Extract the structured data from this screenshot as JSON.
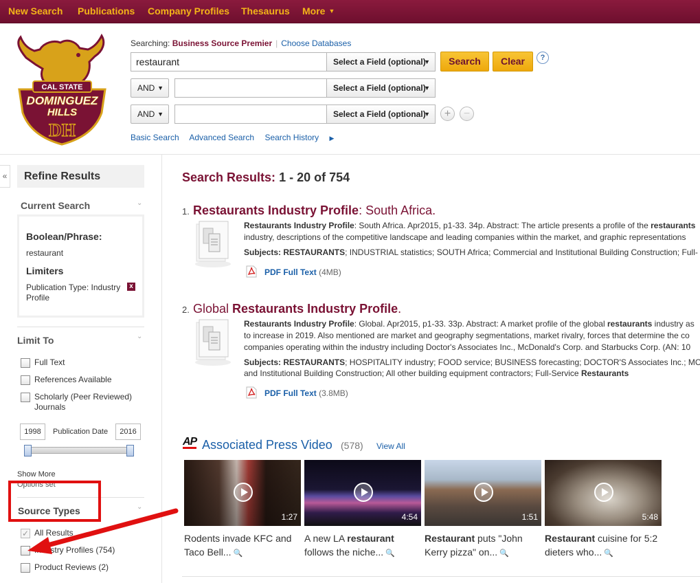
{
  "nav": {
    "items": [
      "New Search",
      "Publications",
      "Company Profiles",
      "Thesaurus",
      "More"
    ],
    "colors": {
      "bar": "#7a1234",
      "text": "#f3b418"
    }
  },
  "logo": {
    "line1": "CAL STATE",
    "line2": "DOMINGUEZ",
    "line3": "HILLS",
    "mono": "DH"
  },
  "search": {
    "searching_label": "Searching:",
    "database": "Business Source Premier",
    "choose_db": "Choose Databases",
    "query": "restaurant",
    "field_label": "Select a Field (optional)",
    "bool1": "AND",
    "bool2": "AND",
    "search_btn": "Search",
    "clear_btn": "Clear",
    "help": "?",
    "add": "+",
    "remove": "−",
    "links": [
      "Basic Search",
      "Advanced Search",
      "Search History"
    ]
  },
  "refine": {
    "title": "Refine Results",
    "collapse": "«",
    "current_search": {
      "title": "Current Search",
      "boolean_label": "Boolean/Phrase:",
      "boolean_value": "restaurant",
      "limiters_label": "Limiters",
      "limiter_line1": "Publication Type: Industry",
      "limiter_line2": "Profile",
      "remove": "x"
    },
    "limit_to": {
      "title": "Limit To",
      "options": [
        "Full Text",
        "References Available",
        "Scholarly (Peer Reviewed)",
        "Journals"
      ],
      "year_from": "1998",
      "year_to": "2016",
      "date_label": "Publication Date",
      "show_more": "Show More",
      "options_set": "Options set"
    },
    "source_types": {
      "title": "Source Types",
      "items": [
        "All Results",
        "Industry Profiles (754)",
        "Product Reviews (2)"
      ]
    }
  },
  "results": {
    "header_label": "Search Results:",
    "header_count": "1 - 20 of 754",
    "items": [
      {
        "num": "1.",
        "title_bold": "Restaurants Industry Profile",
        "title_rest": ": South Africa.",
        "line1_bold": "Restaurants Industry Profile",
        "line1": ": South Africa. Apr2015, p1-33. 34p. Abstract: The article presents a profile of the ",
        "line1_bold2": "restaurants",
        "line2": "industry, descriptions of the competitive landscape and leading companies within the market, and graphic representations",
        "subj_label": "Subjects: ",
        "subj_bold": "RESTAURANTS",
        "subj_rest": "; INDUSTRIAL statistics; SOUTH Africa; Commercial and Institutional Building Construction; Full-",
        "pdf_label": "PDF Full Text",
        "pdf_size": "(4MB)"
      },
      {
        "num": "2.",
        "title_pre": "Global ",
        "title_bold": "Restaurants Industry Profile",
        "title_rest": ".",
        "line1_bold": "Restaurants Industry Profile",
        "line1": ": Global. Apr2015, p1-33. 33p. Abstract: A market profile of the global ",
        "line1_bold2": "restaurants",
        "line1_end": " industry as",
        "line2": "to increase in 2019. Also mentioned are market and geography segmentations, market rivalry, forces that determine the co",
        "line3": "companies operating within the industry including Doctor's Associates Inc., McDonald's Corp. and Starbucks Corp. (AN: 10",
        "subj_label": "Subjects: ",
        "subj_bold": "RESTAURANTS",
        "subj_rest": "; HOSPITALITY industry; FOOD service; BUSINESS forecasting; DOCTOR'S Associates Inc.; MCD",
        "subj_line2": "and Institutional Building Construction; All other building equipment contractors; Full-Service ",
        "subj_line2_bold": "Restaurants",
        "pdf_label": "PDF Full Text",
        "pdf_size": "(3.8MB)"
      }
    ]
  },
  "videos": {
    "logo": "AP",
    "title": "Associated Press Video",
    "count": "(578)",
    "view_all": "View All",
    "items": [
      {
        "duration": "1:27",
        "cap_pre": "",
        "cap_bold": "",
        "cap_rest": "Rodents invade KFC and Taco Bell..."
      },
      {
        "duration": "4:54",
        "cap_pre": "A new LA ",
        "cap_bold": "restaurant",
        "cap_rest": " follows the niche..."
      },
      {
        "duration": "1:51",
        "cap_pre": "",
        "cap_bold": "Restaurant",
        "cap_rest": " puts \"John Kerry pizza\" on..."
      },
      {
        "duration": "5:48",
        "cap_pre": "",
        "cap_bold": "Restaurant",
        "cap_rest": " cuisine for 5:2 dieters who..."
      }
    ]
  }
}
